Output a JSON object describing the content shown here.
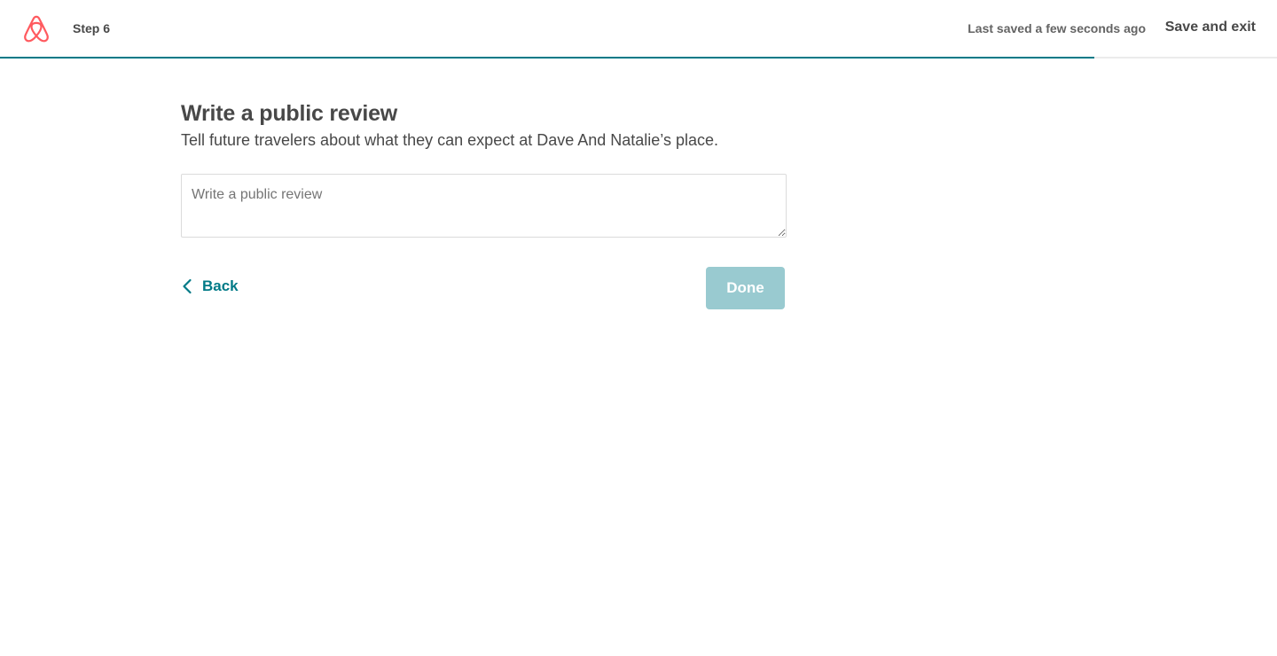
{
  "header": {
    "step_label": "Step 6",
    "last_saved": "Last saved a few seconds ago",
    "save_exit_label": "Save and exit",
    "logo_icon": "airbnb-belo-logo",
    "logo_color": "#ff5a5f"
  },
  "progress": {
    "fraction": 0.857,
    "color": "#007a87",
    "track_color": "#ebebeb"
  },
  "main": {
    "title": "Write a public review",
    "subtitle": "Tell future travelers about what they can expect at Dave And Natalie’s place.",
    "review_input": {
      "placeholder": "Write a public review",
      "value": ""
    },
    "back_label": "Back",
    "back_icon": "chevron-left-icon",
    "done_label": "Done",
    "done_disabled": true,
    "accent_color": "#007a87"
  }
}
